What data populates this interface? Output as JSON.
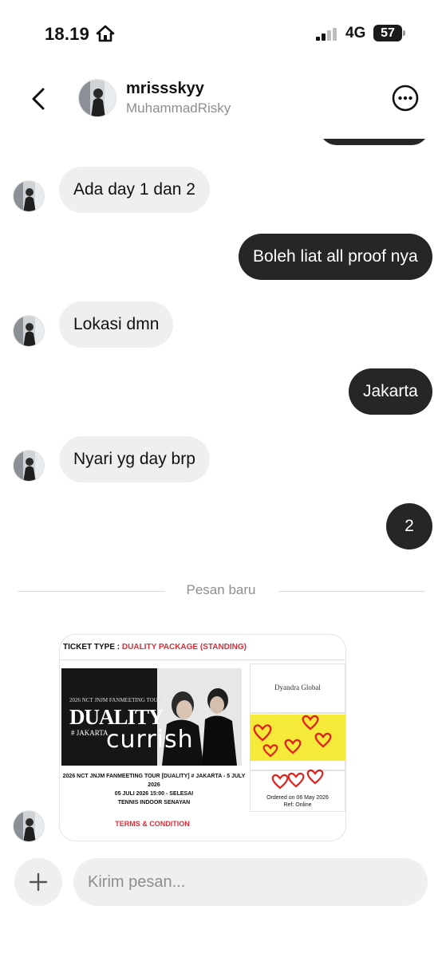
{
  "status_bar": {
    "time": "18.19",
    "network": "4G",
    "battery_level": "57"
  },
  "header": {
    "username": "mrissskyy",
    "display_name": "MuhammadRisky"
  },
  "messages": [
    {
      "direction": "incoming",
      "text": "Ada day 1 dan 2"
    },
    {
      "direction": "outgoing",
      "text": "Boleh liat all proof nya"
    },
    {
      "direction": "incoming",
      "text": "Lokasi dmn"
    },
    {
      "direction": "outgoing",
      "text": "Jakarta"
    },
    {
      "direction": "incoming",
      "text": "Nyari yg day brp"
    },
    {
      "direction": "outgoing",
      "text": "2"
    }
  ],
  "divider": {
    "label": "Pesan baru"
  },
  "ticket": {
    "type_label": "TICKET TYPE : ",
    "type_value": "DUALITY PACKAGE (STANDING)",
    "poster_subtitle": "2026 NCT JNJM FANMEETING TOUR",
    "poster_title": "DUALITY",
    "poster_city": "# JAKARTA",
    "poster_scribble": "currish",
    "info_line1": "2026 NCT JNJM FANMEETING TOUR [DUALITY] # JAKARTA - 5 JULY",
    "info_line2": "2026",
    "info_line3": "05 JULI 2026 15:00 - SELESAI",
    "info_line4": "TENNIS INDOOR SENAYAN",
    "organizer": "Dyandra Global",
    "ordered_on": "Ordered on 06 May 2026",
    "ref": "Ref: Online",
    "terms": "TERMS & CONDITION"
  },
  "composer": {
    "placeholder": "Kirim pesan..."
  },
  "colors": {
    "outgoing_bubble": "#262626",
    "incoming_bubble": "#efefef",
    "accent_red": "#d6303a",
    "highlight_yellow": "#f5e93a"
  },
  "icons": [
    "home-icon",
    "signal-icon",
    "back-arrow-icon",
    "more-options-icon",
    "plus-icon",
    "heart-doodle-icon"
  ]
}
